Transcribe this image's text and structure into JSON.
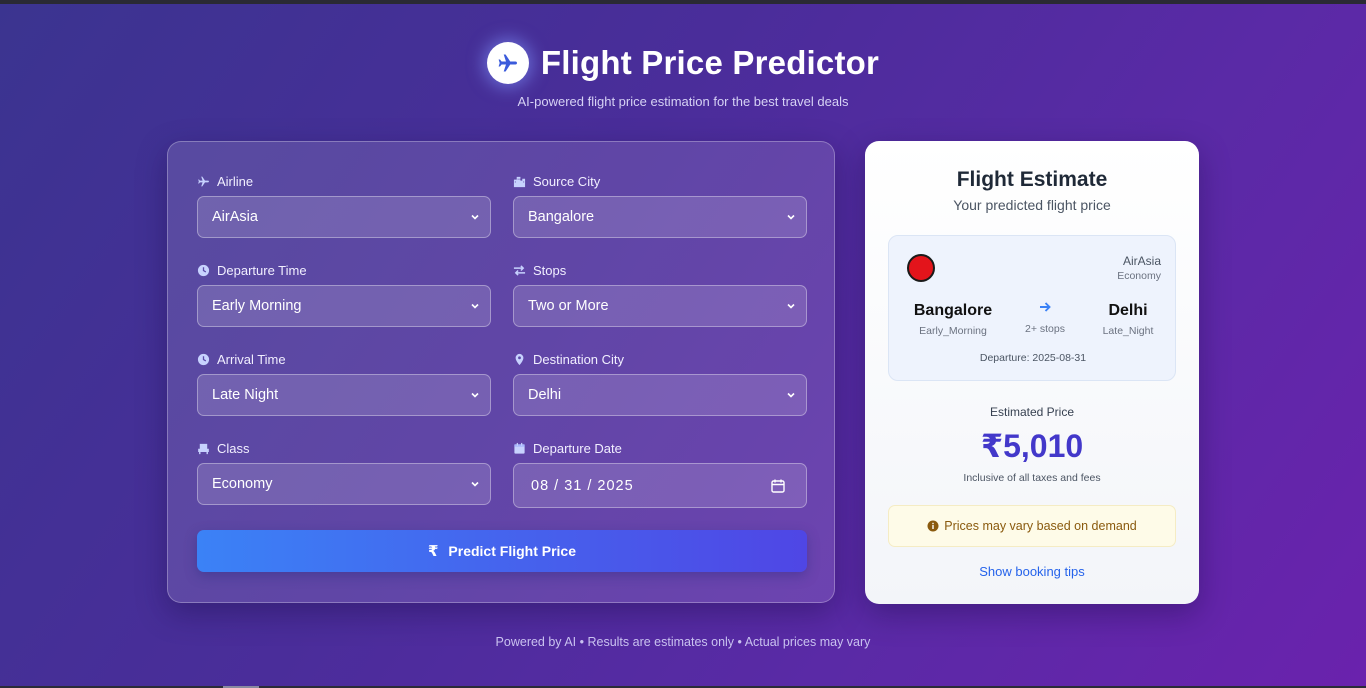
{
  "header": {
    "title": "Flight Price Predictor",
    "subtitle": "AI-powered flight price estimation for the best travel deals"
  },
  "form": {
    "fields": [
      {
        "label": "Airline",
        "value": "AirAsia",
        "icon": "plane-icon"
      },
      {
        "label": "Source City",
        "value": "Bangalore",
        "icon": "city-icon"
      },
      {
        "label": "Departure Time",
        "value": "Early Morning",
        "icon": "clock-icon"
      },
      {
        "label": "Stops",
        "value": "Two or More",
        "icon": "exchange-icon"
      },
      {
        "label": "Arrival Time",
        "value": "Late Night",
        "icon": "clock-icon"
      },
      {
        "label": "Destination City",
        "value": "Delhi",
        "icon": "map-pin-icon"
      },
      {
        "label": "Class",
        "value": "Economy",
        "icon": "seat-icon"
      },
      {
        "label": "Departure Date",
        "value": "08 / 31 / 2025",
        "icon": "calendar-icon"
      }
    ],
    "predict_label": "Predict Flight Price"
  },
  "result": {
    "title": "Flight Estimate",
    "subtitle": "Your predicted flight price",
    "ticket": {
      "airline": "AirAsia",
      "class": "Economy",
      "source_city": "Bangalore",
      "source_time": "Early_Morning",
      "stops": "2+ stops",
      "dest_city": "Delhi",
      "dest_time": "Late_Night",
      "departure": "Departure: 2025-08-31"
    },
    "estimated_label": "Estimated Price",
    "price": "₹5,010",
    "price_note": "Inclusive of all taxes and fees",
    "warning": "Prices may vary based on demand",
    "tips_link": "Show booking tips"
  },
  "footer": "Powered by AI • Results are estimates only • Actual prices may vary",
  "colors": {
    "accent": "#4338ca",
    "button_start": "#3b82f6",
    "button_end": "#4f46e5",
    "link": "#2563eb",
    "airline_logo": "#e3141b"
  }
}
